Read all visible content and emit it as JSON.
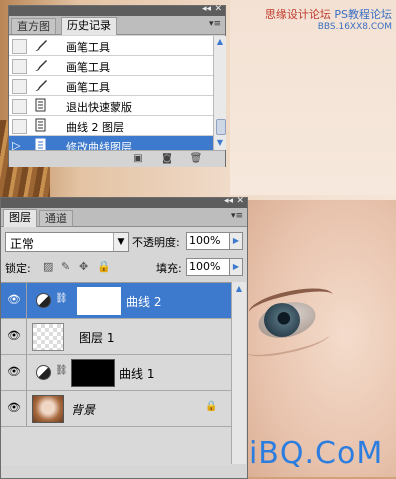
{
  "watermark": {
    "top_left": "思缘设计论坛",
    "top_right_prefix": "PS教程论坛",
    "top_right_url": "BBS.16XX8.COM",
    "bottom": "UiBQ.CoM"
  },
  "history_panel": {
    "tabs": [
      "直方图",
      "历史记录"
    ],
    "active_tab": "历史记录",
    "items": [
      {
        "label": "画笔工具",
        "icon": "brush-icon"
      },
      {
        "label": "画笔工具",
        "icon": "brush-icon"
      },
      {
        "label": "画笔工具",
        "icon": "brush-icon"
      },
      {
        "label": "退出快速蒙版",
        "icon": "history-state-icon"
      },
      {
        "label": "曲线 2 图层",
        "icon": "history-state-icon"
      },
      {
        "label": "修改曲线图层",
        "icon": "history-state-icon",
        "selected": true
      }
    ],
    "footer_icons": [
      "new-document-from-state-icon",
      "snapshot-icon",
      "trash-icon"
    ]
  },
  "layers_panel": {
    "tabs": [
      "图层",
      "通道"
    ],
    "active_tab": "图层",
    "blend_mode": "正常",
    "opacity_label": "不透明度:",
    "opacity_value": "100%",
    "lock_label": "锁定:",
    "fill_label": "填充:",
    "fill_value": "100%",
    "layers": [
      {
        "name": "曲线 2",
        "type": "adjustment",
        "mask": "white",
        "selected": true
      },
      {
        "name": "图层 1",
        "type": "transparent"
      },
      {
        "name": "曲线 1",
        "type": "adjustment",
        "mask": "black"
      },
      {
        "name": "背景",
        "type": "background",
        "locked": true
      }
    ]
  },
  "colors": {
    "selection": "#3d79cc",
    "panel_bg": "#d6d6d6",
    "watermark_blue": "#2b7de0",
    "watermark_red": "#c0392b"
  }
}
